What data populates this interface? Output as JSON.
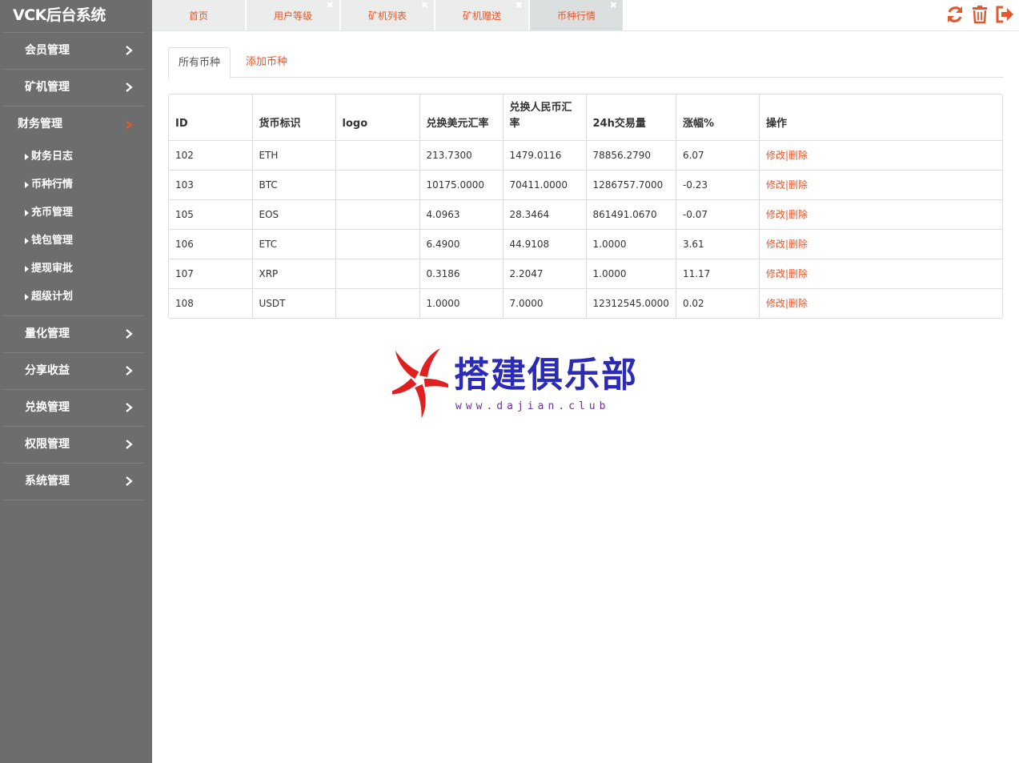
{
  "app": {
    "title": "VCK后台系统"
  },
  "colors": {
    "accent": "#e3572c",
    "sidebar_bg": "#6d6d6d",
    "watermark_blue": "#2b2bb8",
    "watermark_red": "#e02020"
  },
  "sidebar": {
    "items": [
      {
        "label": "会员管理",
        "expanded": false
      },
      {
        "label": "矿机管理",
        "expanded": false
      },
      {
        "label": "财务管理",
        "expanded": true,
        "children": [
          "财务日志",
          "币种行情",
          "充币管理",
          "钱包管理",
          "提现审批",
          "超级计划"
        ]
      },
      {
        "label": "量化管理",
        "expanded": false
      },
      {
        "label": "分享收益",
        "expanded": false
      },
      {
        "label": "兑换管理",
        "expanded": false
      },
      {
        "label": "权限管理",
        "expanded": false
      },
      {
        "label": "系统管理",
        "expanded": false
      }
    ]
  },
  "tabs": [
    {
      "label": "首页",
      "closable": false
    },
    {
      "label": "用户等级",
      "closable": true
    },
    {
      "label": "矿机列表",
      "closable": true
    },
    {
      "label": "矿机赠送",
      "closable": true
    },
    {
      "label": "币种行情",
      "closable": true,
      "active": true
    }
  ],
  "toolbar": {
    "icons": [
      "refresh-icon",
      "trash-icon",
      "logout-icon"
    ]
  },
  "subtabs": {
    "all": "所有币种",
    "add": "添加币种"
  },
  "table": {
    "headers": [
      "ID",
      "货币标识",
      "logo",
      "兑换美元汇率",
      "兑换人民币汇率",
      "24h交易量",
      "涨幅%",
      "操作"
    ],
    "rows": [
      {
        "id": "102",
        "symbol": "ETH",
        "logo": "",
        "usd": "213.7300",
        "cny": "1479.0116",
        "vol": "78856.2790",
        "change": "6.07"
      },
      {
        "id": "103",
        "symbol": "BTC",
        "logo": "",
        "usd": "10175.0000",
        "cny": "70411.0000",
        "vol": "1286757.7000",
        "change": "-0.23"
      },
      {
        "id": "105",
        "symbol": "EOS",
        "logo": "",
        "usd": "4.0963",
        "cny": "28.3464",
        "vol": "861491.0670",
        "change": "-0.07"
      },
      {
        "id": "106",
        "symbol": "ETC",
        "logo": "",
        "usd": "6.4900",
        "cny": "44.9108",
        "vol": "1.0000",
        "change": "3.61"
      },
      {
        "id": "107",
        "symbol": "XRP",
        "logo": "",
        "usd": "0.3186",
        "cny": "2.2047",
        "vol": "1.0000",
        "change": "11.17"
      },
      {
        "id": "108",
        "symbol": "USDT",
        "logo": "",
        "usd": "1.0000",
        "cny": "7.0000",
        "vol": "12312545.0000",
        "change": "0.02"
      }
    ],
    "actions": {
      "edit": "修改",
      "sep": "|",
      "delete": "删除"
    }
  },
  "watermark": {
    "title": "搭建俱乐部",
    "url": "www.dajian.club"
  }
}
